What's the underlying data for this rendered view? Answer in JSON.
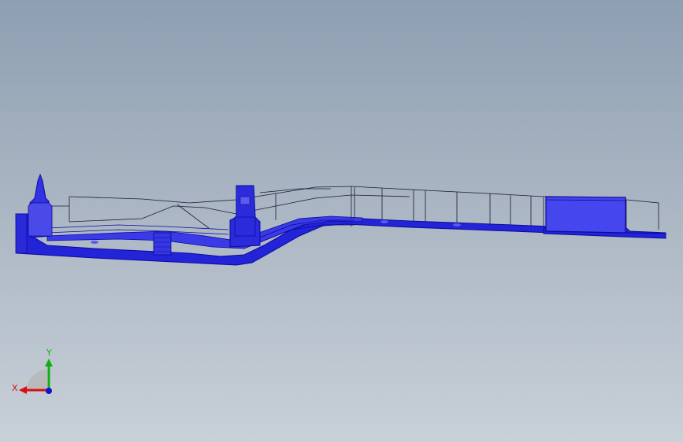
{
  "viewport": {
    "background_top": "#8e9fb2",
    "background_bottom": "#c8d0d8"
  },
  "model": {
    "shell_fill": "#2323d8",
    "shell_dark": "#0b0b9c",
    "shell_light": "#4a4ae8",
    "wire_color": "#1a1a3a",
    "box_fill": "#4646ef"
  },
  "triad": {
    "x_label": "X",
    "y_label": "Y",
    "x_color": "#d81010",
    "y_color": "#10b010",
    "z_color": "#1010d8"
  }
}
